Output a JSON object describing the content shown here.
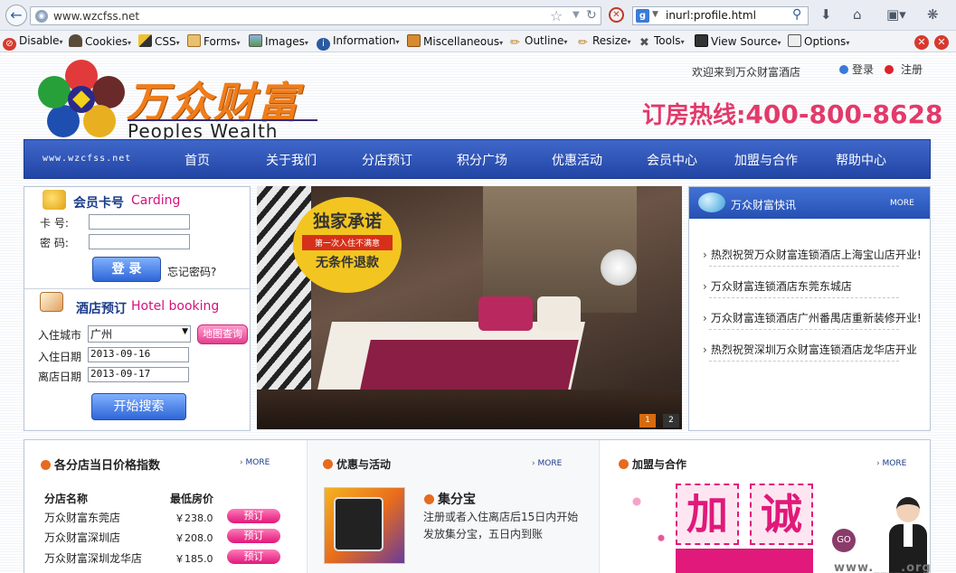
{
  "browser": {
    "url": "www.wzcfss.net",
    "search_query": "inurl:profile.html",
    "search_engine_letter": "g"
  },
  "webdev_toolbar": {
    "items": [
      "Disable",
      "Cookies",
      "CSS",
      "Forms",
      "Images",
      "Information",
      "Miscellaneous",
      "Outline",
      "Resize",
      "Tools",
      "View Source",
      "Options"
    ]
  },
  "header": {
    "logo_cn": "万众财富",
    "logo_en": "Peoples Wealth",
    "welcome": "欢迎来到万众财富酒店",
    "login": "登录",
    "register": "注册",
    "hotline_label": "订房热线:",
    "hotline_number": "400-800-8628"
  },
  "nav": {
    "site": "www.wzcfss.net",
    "items": [
      "首页",
      "关于我们",
      "分店预订",
      "积分广场",
      "优惠活动",
      "会员中心",
      "加盟与合作",
      "帮助中心"
    ]
  },
  "member": {
    "title": "会员卡号",
    "title_en": "Carding",
    "card_label": "卡  号:",
    "pwd_label": "密  码:",
    "login_btn": "登 录",
    "forgot": "忘记密码?"
  },
  "booking": {
    "title": "酒店预订",
    "title_en": "Hotel booking",
    "city_label": "入住城市",
    "city_value": "广州",
    "map_btn": "地图查询",
    "checkin_label": "入住日期",
    "checkin_value": "2013-09-16",
    "checkout_label": "离店日期",
    "checkout_value": "2013-09-17",
    "search_btn": "开始搜索"
  },
  "banner": {
    "line1": "独家承诺",
    "line2": "第一次入住不满意",
    "line3": "无条件退款",
    "pages": [
      "1",
      "2"
    ]
  },
  "news": {
    "title": "万众财富快讯",
    "more": "MORE",
    "items": [
      "热烈祝贺万众财富连锁酒店上海宝山店开业!",
      "万众财富连锁酒店东莞东城店",
      "万众财富连锁酒店广州番禺店重新装修开业!",
      "热烈祝贺深圳万众财富连锁酒店龙华店开业"
    ]
  },
  "prices": {
    "title": "各分店当日价格指数",
    "more": "MORE",
    "col_name": "分店名称",
    "col_price": "最低房价",
    "book_label": "预订",
    "rows": [
      {
        "name": "万众财富东莞店",
        "price": "￥238.0"
      },
      {
        "name": "万众财富深圳店",
        "price": "￥208.0"
      },
      {
        "name": "万众财富深圳龙华店",
        "price": "￥185.0"
      }
    ]
  },
  "promo": {
    "title": "优惠与活动",
    "more": "MORE",
    "item_title": "集分宝",
    "item_desc1": "注册或者入住离店后15日内开始",
    "item_desc2": "发放集分宝，五日内到账"
  },
  "join": {
    "title": "加盟与合作",
    "more": "MORE",
    "chars": [
      "加",
      "诚"
    ],
    "go": "GO",
    "watermark": "www.____.org"
  }
}
